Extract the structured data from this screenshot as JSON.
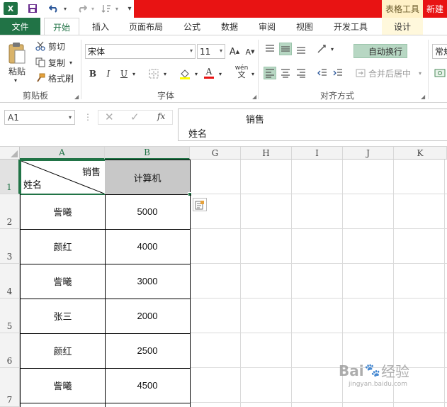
{
  "title_bar": {
    "logo_text": "X",
    "context_tool_title": "表格工具",
    "new_label": "新建"
  },
  "tabs": [
    {
      "label": "文件"
    },
    {
      "label": "开始"
    },
    {
      "label": "插入"
    },
    {
      "label": "页面布局"
    },
    {
      "label": "公式"
    },
    {
      "label": "数据"
    },
    {
      "label": "审阅"
    },
    {
      "label": "视图"
    },
    {
      "label": "开发工具"
    },
    {
      "label": "设计"
    }
  ],
  "ribbon": {
    "clipboard": {
      "paste_label": "粘贴",
      "cut_label": "剪切",
      "copy_label": "复制",
      "format_painter_label": "格式刷",
      "group_label": "剪贴板"
    },
    "font": {
      "font_name": "宋体",
      "font_size": "11",
      "bold": "B",
      "italic": "I",
      "underline": "U",
      "grow": "A",
      "shrink": "A",
      "font_color_glyph": "A",
      "phonetic_glyph": "wén",
      "group_label": "字体"
    },
    "alignment": {
      "wrap_text_label": "自动换行",
      "merge_center_label": "合并后居中",
      "group_label": "对齐方式"
    },
    "number": {
      "format_value": "常规"
    }
  },
  "formula_bar": {
    "name_box": "A1",
    "fx_label": "fx",
    "content_line1": "销售",
    "content_line2": "姓名"
  },
  "sheet": {
    "columns": [
      "A",
      "B",
      "G",
      "H",
      "I",
      "J",
      "K"
    ],
    "rows": [
      "1",
      "2",
      "3",
      "4",
      "5",
      "6",
      "7"
    ],
    "header_top_right": "销售",
    "header_bottom_left": "姓名",
    "header_b": "计算机",
    "data": [
      {
        "name": "訾曦",
        "value": "5000"
      },
      {
        "name": "颜红",
        "value": "4000"
      },
      {
        "name": "訾曦",
        "value": "3000"
      },
      {
        "name": "张三",
        "value": "2000"
      },
      {
        "name": "颜红",
        "value": "2500"
      },
      {
        "name": "訾曦",
        "value": "4500"
      }
    ]
  },
  "watermark": {
    "brand": "Bai",
    "brand_suffix": "经验",
    "url": "jingyan.baidu.com"
  },
  "colors": {
    "excel_green": "#217346",
    "banner_red": "#e81313",
    "header_fill": "#c8c8c8"
  }
}
